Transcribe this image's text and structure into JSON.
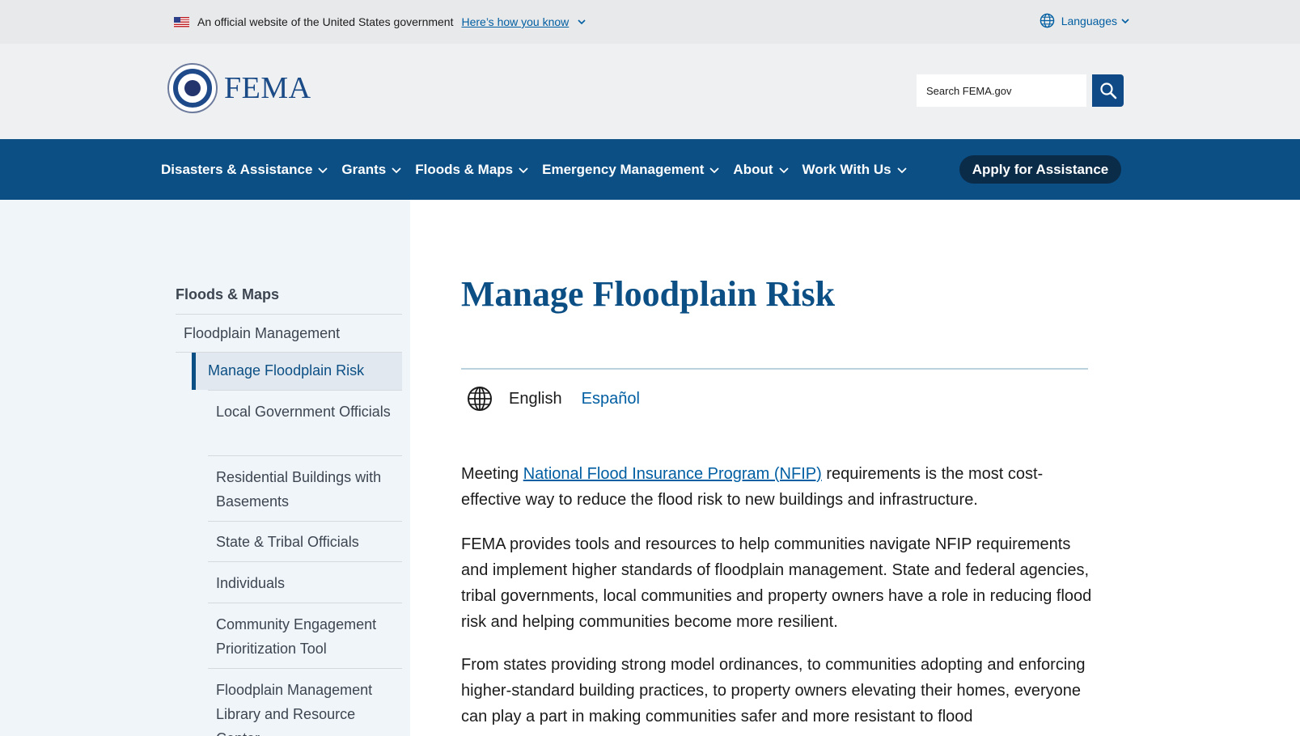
{
  "gov_banner": {
    "text": "An official website of the United States government",
    "link": "Here’s how you know",
    "languages": "Languages"
  },
  "header": {
    "logo_text": "FEMA",
    "search_placeholder": "Search FEMA.gov"
  },
  "nav": {
    "items": [
      {
        "label": "Disasters & Assistance"
      },
      {
        "label": "Grants"
      },
      {
        "label": "Floods & Maps"
      },
      {
        "label": "Emergency Management"
      },
      {
        "label": "About"
      },
      {
        "label": "Work With Us"
      }
    ],
    "apply_label": "Apply for Assistance"
  },
  "sidebar": {
    "title": "Floods & Maps",
    "level1": "Floodplain Management",
    "active": "Manage Floodplain Risk",
    "children": [
      {
        "label": "Local Government Officials"
      },
      {
        "label": "Residential Buildings with Basements"
      },
      {
        "label": "State & Tribal Officials"
      },
      {
        "label": "Individuals"
      },
      {
        "label": "Community Engagement Prioritization Tool"
      },
      {
        "label": "Floodplain Management Library and Resource Center"
      }
    ]
  },
  "main": {
    "title": "Manage Floodplain Risk",
    "lang_current": "English",
    "lang_alt": "Español",
    "p1_before": "Meeting ",
    "p1_link": "National Flood Insurance Program (NFIP)",
    "p1_after": " requirements is the most cost-effective way to reduce the flood risk to new buildings and infrastructure.",
    "p2": "FEMA provides tools and resources to help communities navigate NFIP requirements and implement higher standards of floodplain management. State and federal agencies, tribal governments, local communities and property owners have a role in reducing flood risk and helping communities become more resilient.",
    "p3": "From states providing strong model ordinances, to communities adopting and enforcing higher-standard building practices, to property owners elevating their homes, everyone can play a part in making communities safer and more resistant to flood"
  },
  "colors": {
    "nav_bg": "#0b4f85",
    "apply_bg": "#0b2c49",
    "link": "#005ea2",
    "title": "#0b4f85"
  }
}
